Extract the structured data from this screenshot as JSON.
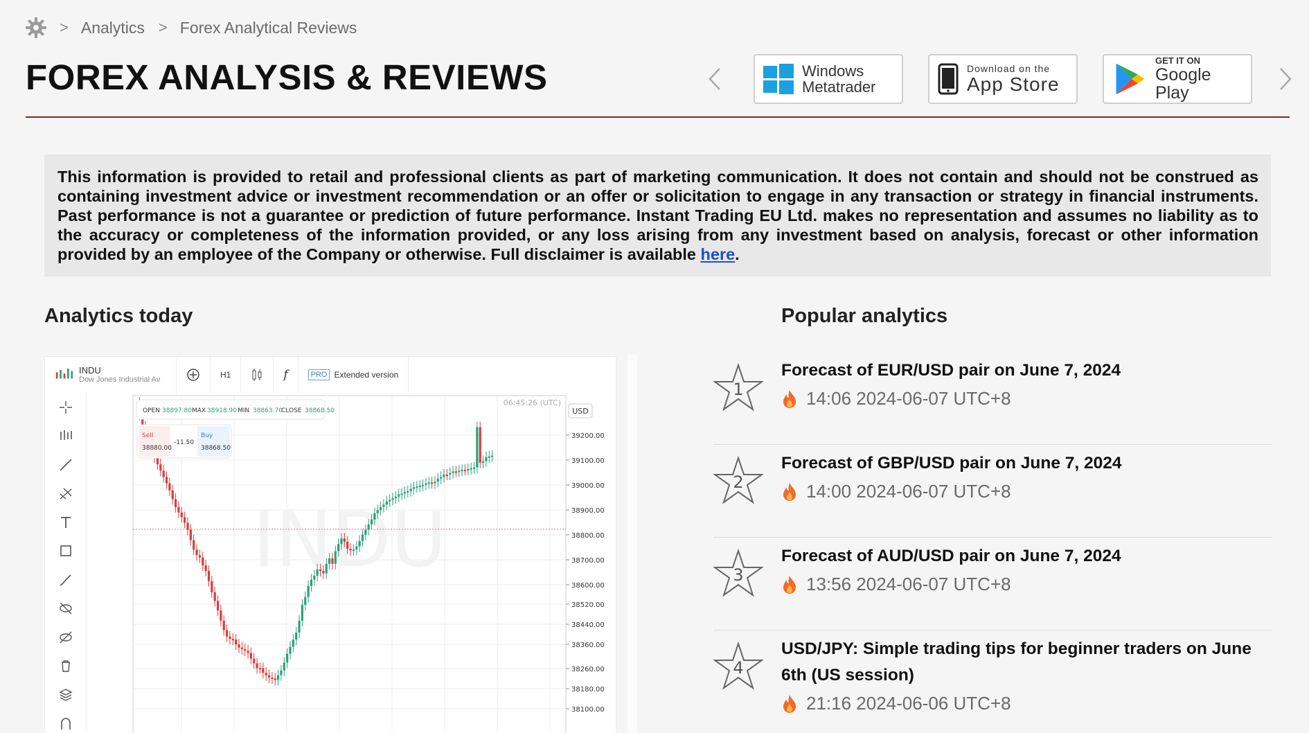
{
  "breadcrumb": {
    "home_icon": "gear-logo-icon",
    "items": [
      "Analytics",
      "Forex Analytical Reviews"
    ]
  },
  "page": {
    "title": "FOREX ANALYSIS & REVIEWS"
  },
  "stores": {
    "windows": {
      "line1": "Windows",
      "line2": "Metatrader",
      "icon": "windows-icon"
    },
    "appstore": {
      "line1": "Download on the",
      "line2": "App Store",
      "icon": "phone-icon"
    },
    "googleplay": {
      "line1": "GET IT ON",
      "line2": "Google Play",
      "icon": "google-play-icon"
    }
  },
  "disclaimer": {
    "text": "This information is provided to retail and professional clients as part of marketing communication. It does not contain and should not be construed as containing investment advice or investment recommendation or an offer or solicitation to engage in any transaction or strategy in financial instruments. Past performance is not a guarantee or prediction of future performance. Instant Trading EU Ltd. makes no representation and assumes no liability as to the accuracy or completeness of the information provided, or any loss arising from any investment based on analysis, forecast or other information provided by an employee of the Company or otherwise. Full disclaimer is available ",
    "link_text": "here",
    "end": "."
  },
  "sections": {
    "analytics_today": "Analytics today",
    "popular": "Popular analytics"
  },
  "chart_widget": {
    "symbol": "INDU",
    "symbol_name": "Dow Jones Industrial Av",
    "timeframe": "H1",
    "pro_badge": "PRO",
    "extended": "Extended version",
    "time": "06:45:26 (UTC)",
    "currency": "USD",
    "ohlc": {
      "open_label": "OPEN",
      "open": "38897.80",
      "max_label": "MAX",
      "max": "38918.90",
      "min_label": "MIN",
      "min": "38863.70",
      "close_label": "CLOSE",
      "close": "38868.50"
    },
    "sell_label": "Sell",
    "sell_price": "38880.00",
    "spread": "-11.50",
    "buy_label": "Buy",
    "buy_price": "38868.50",
    "watermark": "INDU",
    "colors": {
      "up": "#2aa17a",
      "down": "#d93b3b",
      "grid": "#ececec",
      "current": "#e07070"
    }
  },
  "chart_data": {
    "type": "candlestick",
    "y_ticks": [
      "39200.00",
      "39100.00",
      "39000.00",
      "38900.00",
      "38800.00",
      "38700.00",
      "38600.00",
      "38520.00",
      "38440.00",
      "38360.00",
      "38260.00",
      "38180.00",
      "38100.00"
    ],
    "current_price": 38868.5
  },
  "popular": [
    {
      "rank": "1",
      "title": "Forecast of EUR/USD pair on June 7, 2024",
      "time": "14:06 2024-06-07 UTC+8"
    },
    {
      "rank": "2",
      "title": "Forecast of GBP/USD pair on June 7, 2024",
      "time": "14:00 2024-06-07 UTC+8"
    },
    {
      "rank": "3",
      "title": "Forecast of AUD/USD pair on June 7, 2024",
      "time": "13:56 2024-06-07 UTC+8"
    },
    {
      "rank": "4",
      "title": "USD/JPY: Simple trading tips for beginner traders on June 6th (US session)",
      "time": "21:16 2024-06-06 UTC+8"
    }
  ]
}
